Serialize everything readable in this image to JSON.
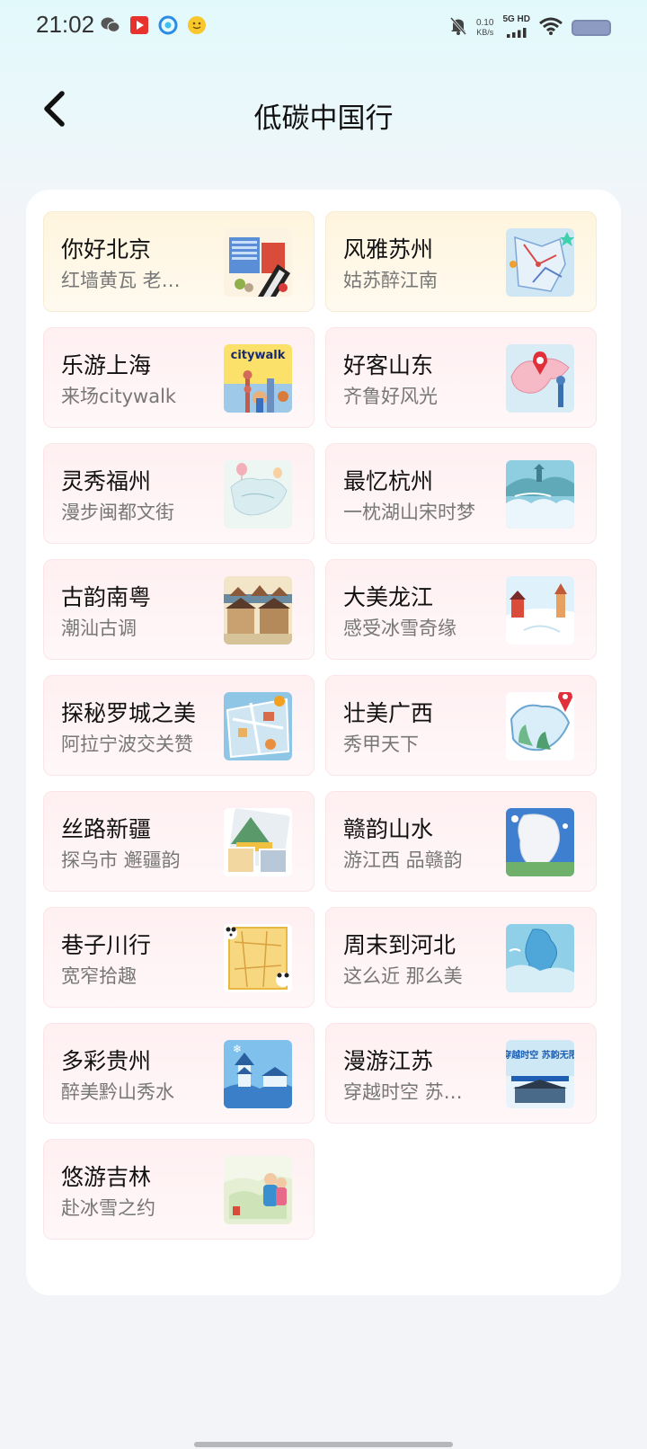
{
  "status_bar": {
    "time": "21:02",
    "net_speed_value": "0.10",
    "net_speed_unit": "KB/s",
    "network_type": "5G HD",
    "icons": [
      "wechat-icon",
      "video-app-icon",
      "qq-browser-icon",
      "emoji-app-icon",
      "mute-icon",
      "signal-icon",
      "wifi-icon",
      "battery-icon"
    ]
  },
  "header": {
    "back_icon": "chevron-left-icon",
    "title": "低碳中国行"
  },
  "cards": [
    {
      "title": "你好北京",
      "subtitle": "红墙黄瓦 老…",
      "style": "gold",
      "thumb": "beijing-illustration"
    },
    {
      "title": "风雅苏州",
      "subtitle": "姑苏醉江南",
      "style": "gold",
      "thumb": "suzhou-map"
    },
    {
      "title": "乐游上海",
      "subtitle": "来场citywalk",
      "style": "pink",
      "thumb": "shanghai-citywalk",
      "thumb_text": "citywalk"
    },
    {
      "title": "好客山东",
      "subtitle": "齐鲁好风光",
      "style": "pink",
      "thumb": "shandong-map"
    },
    {
      "title": "灵秀福州",
      "subtitle": "漫步闽都文街",
      "style": "pink",
      "thumb": "fuzhou-map"
    },
    {
      "title": "最忆杭州",
      "subtitle": "一枕湖山宋时梦",
      "style": "pink",
      "thumb": "hangzhou-clouds"
    },
    {
      "title": "古韵南粤",
      "subtitle": "潮汕古调",
      "style": "pink",
      "thumb": "chaoshan-town"
    },
    {
      "title": "大美龙江",
      "subtitle": "感受冰雪奇缘",
      "style": "pink",
      "thumb": "heilongjiang-snow"
    },
    {
      "title": "探秘罗城之美",
      "subtitle": "阿拉宁波交关赞",
      "style": "pink",
      "thumb": "ningbo-map"
    },
    {
      "title": "壮美广西",
      "subtitle": "秀甲天下",
      "style": "pink",
      "thumb": "guangxi-map"
    },
    {
      "title": "丝路新疆",
      "subtitle": "探乌市 邂疆韵",
      "style": "pink",
      "thumb": "xinjiang-photos"
    },
    {
      "title": "赣韵山水",
      "subtitle": "游江西 品赣韵",
      "style": "pink",
      "thumb": "jiangxi-map"
    },
    {
      "title": "巷子川行",
      "subtitle": "宽窄拾趣",
      "style": "pink",
      "thumb": "sichuan-panda-map"
    },
    {
      "title": "周末到河北",
      "subtitle": "这么近 那么美",
      "style": "pink",
      "thumb": "hebei-map"
    },
    {
      "title": "多彩贵州",
      "subtitle": "醉美黔山秀水",
      "style": "pink",
      "thumb": "guizhou-snow"
    },
    {
      "title": "漫游江苏",
      "subtitle": "穿越时空 苏…",
      "style": "pink",
      "thumb": "jiangsu-poster",
      "thumb_text": "穿越时空 苏韵无限"
    },
    {
      "title": "悠游吉林",
      "subtitle": "赴冰雪之约",
      "style": "pink",
      "thumb": "jilin-illustration"
    }
  ]
}
